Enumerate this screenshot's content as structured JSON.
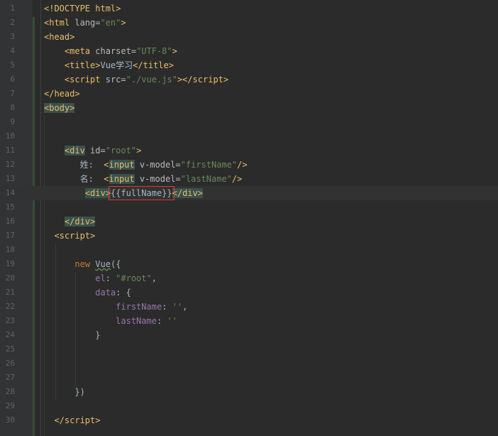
{
  "editor": {
    "lines": [
      {
        "n": "1",
        "html": "<span class=\"tag\">&lt;!DOCTYPE html&gt;</span>"
      },
      {
        "n": "2",
        "html": "<span class=\"tag\">&lt;html</span> <span class=\"attr\">lang=</span><span class=\"val\">\"en\"</span><span class=\"tag\">&gt;</span>"
      },
      {
        "n": "3",
        "html": "<span class=\"tag\">&lt;head&gt;</span>"
      },
      {
        "n": "4",
        "html": "    <span class=\"tag\">&lt;meta</span> <span class=\"attr\">charset=</span><span class=\"val\">\"UTF-8\"</span><span class=\"tag\">&gt;</span>"
      },
      {
        "n": "5",
        "html": "    <span class=\"tag\">&lt;title&gt;</span><span class=\"txt\">Vue学习</span><span class=\"tag\">&lt;/title&gt;</span>"
      },
      {
        "n": "6",
        "html": "    <span class=\"tag\">&lt;script</span> <span class=\"attr\">src=</span><span class=\"val\">\"./vue.js\"</span><span class=\"tag\">&gt;&lt;/script&gt;</span>"
      },
      {
        "n": "7",
        "html": "<span class=\"tag\">&lt;/head&gt;</span>"
      },
      {
        "n": "8",
        "html": "<span class=\"tag-hl\">&lt;body&gt;</span>"
      },
      {
        "n": "9",
        "html": ""
      },
      {
        "n": "10",
        "html": ""
      },
      {
        "n": "11",
        "html": "    <span class=\"tag-hl\">&lt;div</span> <span class=\"attr\">id=</span><span class=\"val\">\"root\"</span><span class=\"tag\">&gt;</span>"
      },
      {
        "n": "12",
        "html": "       <span class=\"txt\">姓:  </span><span class=\"tag\">&lt;</span><span class=\"tag-hl\">input</span> <span class=\"attr\">v-model=</span><span class=\"val\">\"firstName\"</span><span class=\"tag\">/&gt;</span>"
      },
      {
        "n": "13",
        "html": "       <span class=\"txt\">名:  </span><span class=\"tag\">&lt;</span><span class=\"tag-hl\">input</span> <span class=\"attr\">v-model=</span><span class=\"val\">\"lastName\"</span><span class=\"tag\">/&gt;</span>"
      },
      {
        "n": "14",
        "html": "        <span class=\"tag-hl\">&lt;div&gt;</span><span class=\"txt box\">{{fullName}}</span><span class=\"tag-hl\">&lt;/div&gt;</span>"
      },
      {
        "n": "15",
        "html": ""
      },
      {
        "n": "16",
        "html": "    <span class=\"tag-hl\">&lt;/div&gt;</span>"
      },
      {
        "n": "17",
        "html": "  <span class=\"tag\">&lt;script&gt;</span>"
      },
      {
        "n": "18",
        "html": ""
      },
      {
        "n": "19",
        "html": "      <span class=\"kw\">new</span> <span class=\"txt sq\">Vue</span><span class=\"punct\">({</span>"
      },
      {
        "n": "20",
        "html": "          <span class=\"prop\">el</span><span class=\"punct\">: </span><span class=\"val\">\"#root\"</span><span class=\"punct\">,</span>"
      },
      {
        "n": "21",
        "html": "          <span class=\"prop\">data</span><span class=\"punct\">: {</span>"
      },
      {
        "n": "22",
        "html": "              <span class=\"prop\">firstName</span><span class=\"punct\">: </span><span class=\"val\">''</span><span class=\"punct\">,</span>"
      },
      {
        "n": "23",
        "html": "              <span class=\"prop\">lastName</span><span class=\"punct\">: </span><span class=\"val\">''</span>"
      },
      {
        "n": "24",
        "html": "          <span class=\"punct\">}</span>"
      },
      {
        "n": "25",
        "html": ""
      },
      {
        "n": "26",
        "html": ""
      },
      {
        "n": "27",
        "html": ""
      },
      {
        "n": "28",
        "html": "      <span class=\"punct\">})</span>"
      },
      {
        "n": "29",
        "html": ""
      },
      {
        "n": "30",
        "html": "  <span class=\"tag\">&lt;/script&gt;</span>"
      }
    ],
    "current_line": "14"
  }
}
